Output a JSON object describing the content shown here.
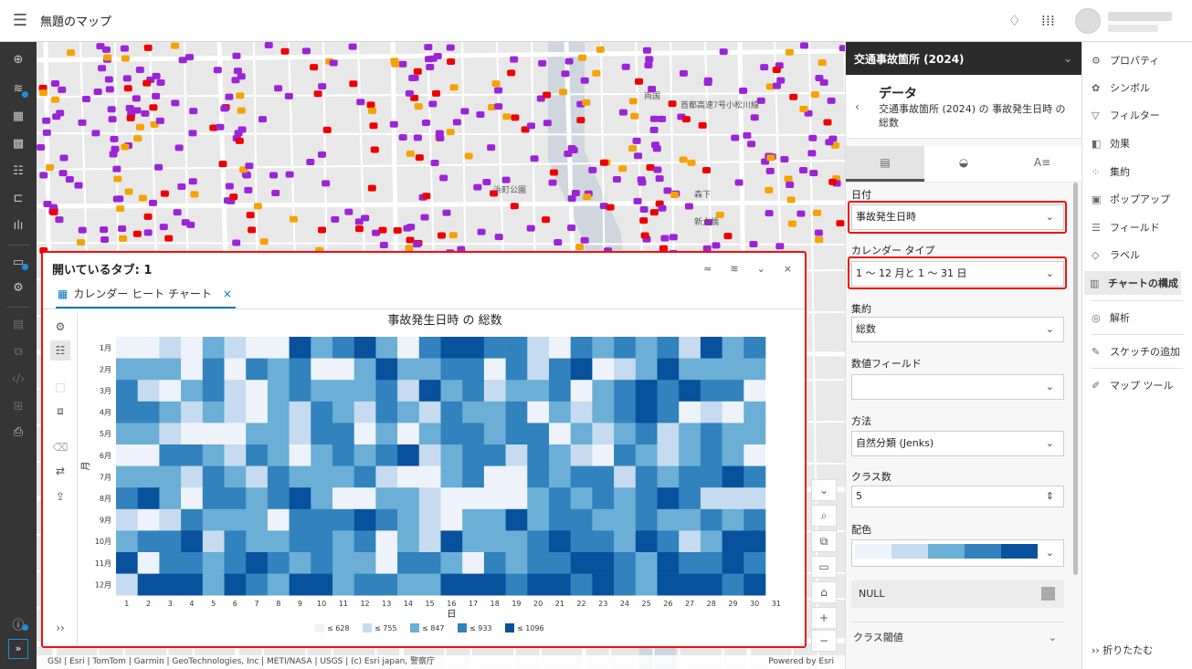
{
  "header": {
    "title": "無題のマップ",
    "menu_icon": "hamburger-icon",
    "bell_icon": "bell-icon",
    "apps_icon": "apps-grid-icon"
  },
  "map": {
    "attribution": "GSI | Esri | TomTom | Garmin | GeoTechnologies, Inc | METI/NASA | USGS | (c) Esri japan, 警察庁",
    "powered_by": "Powered by Esri",
    "labels": [
      "両国",
      "首都高速7号小松川線",
      "森下",
      "新大橋",
      "浜町公園"
    ]
  },
  "chart_panel": {
    "header": "開いているタブ: 1",
    "tab_label": "カレンダー ヒート チャート",
    "tab_close": "×",
    "controls": [
      "≈",
      "≋",
      "⌄",
      "×"
    ],
    "collapse": "››"
  },
  "chart_data": {
    "type": "heatmap",
    "title": "事故発生日時 の 総数",
    "xlabel": "日",
    "ylabel": "月",
    "x": [
      "1",
      "2",
      "3",
      "4",
      "5",
      "6",
      "7",
      "8",
      "9",
      "10",
      "11",
      "12",
      "13",
      "14",
      "15",
      "16",
      "17",
      "18",
      "19",
      "20",
      "21",
      "22",
      "23",
      "24",
      "25",
      "26",
      "27",
      "28",
      "29",
      "30",
      "31"
    ],
    "y": [
      "1月",
      "2月",
      "3月",
      "4月",
      "5月",
      "6月",
      "7月",
      "8月",
      "9月",
      "10月",
      "11月",
      "12月"
    ],
    "legend": [
      {
        "label": "≤ 628",
        "color": "#eef3fb"
      },
      {
        "label": "≤ 755",
        "color": "#c6dbef"
      },
      {
        "label": "≤ 847",
        "color": "#6baed6"
      },
      {
        "label": "≤ 933",
        "color": "#3182bd"
      },
      {
        "label": "≤ 1096",
        "color": "#08519c"
      }
    ],
    "classes": [
      [
        0,
        0,
        1,
        0,
        2,
        1,
        0,
        0,
        4,
        2,
        3,
        4,
        2,
        0,
        3,
        4,
        4,
        3,
        3,
        1,
        0,
        3,
        2,
        3,
        2,
        3,
        1,
        4,
        2,
        3
      ],
      [
        2,
        2,
        2,
        0,
        3,
        0,
        3,
        2,
        3,
        0,
        0,
        2,
        4,
        2,
        2,
        3,
        3,
        0,
        3,
        1,
        3,
        4,
        0,
        1,
        2,
        4,
        2,
        2,
        2,
        2
      ],
      [
        3,
        1,
        0,
        2,
        3,
        1,
        0,
        2,
        3,
        2,
        2,
        2,
        3,
        1,
        4,
        2,
        3,
        1,
        2,
        2,
        3,
        0,
        2,
        3,
        4,
        3,
        4,
        3,
        3,
        0
      ],
      [
        3,
        3,
        2,
        1,
        2,
        1,
        0,
        2,
        1,
        3,
        2,
        1,
        3,
        2,
        1,
        3,
        2,
        2,
        3,
        0,
        2,
        1,
        2,
        3,
        4,
        3,
        0,
        1,
        0,
        2
      ],
      [
        2,
        2,
        1,
        0,
        0,
        0,
        2,
        2,
        1,
        3,
        3,
        0,
        2,
        0,
        2,
        3,
        3,
        2,
        3,
        3,
        0,
        2,
        1,
        2,
        3,
        1,
        2,
        3,
        2,
        2
      ],
      [
        0,
        0,
        3,
        3,
        2,
        1,
        3,
        2,
        0,
        2,
        3,
        2,
        3,
        4,
        1,
        2,
        3,
        3,
        1,
        3,
        2,
        1,
        0,
        3,
        2,
        1,
        2,
        3,
        2,
        0
      ],
      [
        2,
        2,
        2,
        1,
        3,
        2,
        1,
        3,
        2,
        2,
        2,
        3,
        1,
        0,
        0,
        2,
        3,
        0,
        0,
        3,
        2,
        3,
        3,
        1,
        3,
        2,
        3,
        3,
        4,
        3
      ],
      [
        3,
        4,
        2,
        0,
        3,
        3,
        2,
        3,
        4,
        2,
        0,
        0,
        2,
        2,
        1,
        0,
        0,
        0,
        0,
        2,
        3,
        2,
        3,
        2,
        3,
        4,
        3,
        1,
        1,
        1
      ],
      [
        1,
        0,
        1,
        3,
        2,
        2,
        2,
        0,
        3,
        3,
        3,
        4,
        3,
        2,
        1,
        0,
        2,
        2,
        4,
        2,
        3,
        3,
        2,
        2,
        3,
        2,
        2,
        3,
        2,
        3
      ],
      [
        2,
        3,
        3,
        4,
        1,
        3,
        2,
        2,
        3,
        3,
        2,
        3,
        0,
        2,
        1,
        4,
        2,
        2,
        2,
        3,
        4,
        3,
        3,
        2,
        4,
        3,
        1,
        2,
        4,
        4
      ],
      [
        4,
        0,
        3,
        3,
        2,
        3,
        4,
        3,
        2,
        3,
        2,
        2,
        0,
        3,
        3,
        2,
        0,
        3,
        2,
        3,
        3,
        4,
        4,
        3,
        2,
        4,
        3,
        3,
        4,
        3
      ],
      [
        1,
        4,
        4,
        4,
        2,
        4,
        3,
        2,
        4,
        4,
        2,
        3,
        3,
        2,
        2,
        4,
        4,
        4,
        3,
        4,
        4,
        3,
        4,
        3,
        2,
        4,
        4,
        4,
        3,
        4
      ]
    ]
  },
  "right_panel": {
    "layer_title": "交通事故箇所 (2024)",
    "data_heading": "データ",
    "data_sub": "交通事故箇所 (2024) の 事故発生日時 の 総数",
    "tab_icons": [
      "data-tab-icon",
      "series-tab-icon",
      "format-tab-icon"
    ],
    "tab_glyphs": [
      "▤",
      "◒",
      "A≡"
    ],
    "fields": {
      "date_label": "日付",
      "date_value": "事故発生日時",
      "calendar_label": "カレンダー タイプ",
      "calendar_value": "1 〜 12 月と 1 〜 31 日",
      "agg_label": "集約",
      "agg_value": "総数",
      "numfield_label": "数値フィールド",
      "numfield_value": "",
      "method_label": "方法",
      "method_value": "自然分類 (Jenks)",
      "classcount_label": "クラス数",
      "classcount_value": "5",
      "color_label": "配色",
      "null_label": "NULL",
      "classth_label": "クラス閾値"
    }
  },
  "tools": {
    "items": [
      {
        "label": "プロパティ",
        "icon": "properties-icon",
        "glyph": "⚙"
      },
      {
        "label": "シンボル",
        "icon": "symbol-icon",
        "glyph": "✿"
      },
      {
        "label": "フィルター",
        "icon": "filter-icon",
        "glyph": "▽"
      },
      {
        "label": "効果",
        "icon": "effects-icon",
        "glyph": "◧"
      },
      {
        "label": "集約",
        "icon": "aggregation-icon",
        "glyph": "⁘"
      },
      {
        "label": "ポップアップ",
        "icon": "popup-icon",
        "glyph": "▣"
      },
      {
        "label": "フィールド",
        "icon": "fields-icon",
        "glyph": "☰"
      },
      {
        "label": "ラベル",
        "icon": "label-icon",
        "glyph": "◇"
      },
      {
        "label": "チャートの構成",
        "icon": "chart-config-icon",
        "glyph": "▥"
      },
      {
        "label": "解析",
        "icon": "analysis-icon",
        "glyph": "◎"
      },
      {
        "label": "スケッチの追加",
        "icon": "sketch-icon",
        "glyph": "✎"
      },
      {
        "label": "マップ ツール",
        "icon": "map-tools-icon",
        "glyph": "✐"
      }
    ],
    "collapse_label": "›› 折りたたむ"
  }
}
